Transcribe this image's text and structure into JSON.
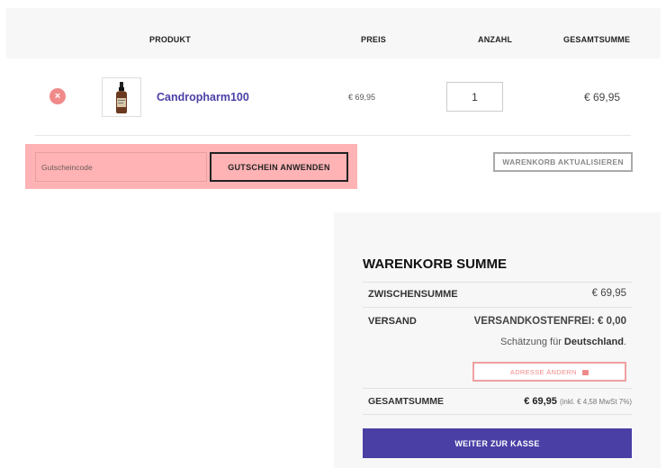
{
  "table_header": {
    "product": "PRODUKT",
    "price": "PREIS",
    "quantity": "ANZAHL",
    "total": "GESAMTSUMME"
  },
  "cart_items": [
    {
      "remove_glyph": "×",
      "image_icon": "product-bottle-icon",
      "name": "Candropharm100",
      "price": "€ 69,95",
      "quantity": "1",
      "total": "€ 69,95"
    }
  ],
  "coupon": {
    "placeholder": "Gutscheincode",
    "apply_label": "GUTSCHEIN ANWENDEN"
  },
  "update_cart_label": "WARENKORB AKTUALISIEREN",
  "totals": {
    "title": "WARENKORB SUMME",
    "subtotal_label": "ZWISCHENSUMME",
    "subtotal_value": "€ 69,95",
    "shipping_label": "VERSAND",
    "shipping_value": "VERSANDKOSTENFREI: € 0,00",
    "estimate_prefix": "Schätzung für",
    "estimate_country": "Deutschland",
    "estimate_suffix": ".",
    "change_address_label": "ADRESSE ÄNDERN",
    "grand_total_label": "GESAMTSUMME",
    "grand_total_value": "€ 69,95",
    "tax_note": "(inkl. € 4,58 MwSt 7%)",
    "checkout_label": "WEITER ZUR KASSE"
  },
  "colors": {
    "accent": "#4a3fa5",
    "remove": "#f08a8a",
    "highlight": "#ffb3b5"
  }
}
